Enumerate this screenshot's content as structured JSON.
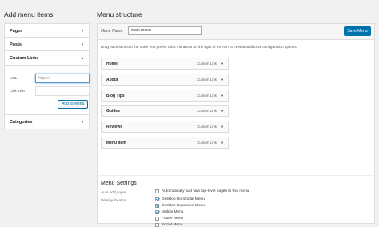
{
  "left": {
    "heading": "Add menu items",
    "pages_label": "Pages",
    "posts_label": "Posts",
    "custom_links_label": "Custom Links",
    "url_label": "URL",
    "url_value": "https://",
    "link_text_label": "Link Text",
    "add_to_menu_label": "Add to Menu",
    "categories_label": "Categories"
  },
  "right": {
    "heading": "Menu structure",
    "menu_name_label": "Menu Name",
    "menu_name_value": "main menu",
    "save_label": "Save Menu",
    "instructions": "Drag each item into the order you prefer. Click the arrow on the right of the item to reveal additional configuration options.",
    "items": [
      {
        "title": "Home",
        "type": "Custom Link"
      },
      {
        "title": "About",
        "type": "Custom Link"
      },
      {
        "title": "Blog Tips",
        "type": "Custom Link"
      },
      {
        "title": "Guides",
        "type": "Custom Link"
      },
      {
        "title": "Reviews",
        "type": "Custom Link"
      },
      {
        "title": "Menu Item",
        "type": "Custom Link"
      }
    ],
    "settings": {
      "title": "Menu Settings",
      "auto_add_label": "Auto add pages",
      "auto_add_text": "Automatically add new top-level pages to this menu",
      "display_label": "Display location",
      "locations": [
        {
          "label": "Desktop Horizontal Menu",
          "checked": true
        },
        {
          "label": "Desktop Expanded Menu",
          "checked": true
        },
        {
          "label": "Mobile Menu",
          "checked": true
        },
        {
          "label": "Footer Menu",
          "checked": false
        },
        {
          "label": "Social Menu",
          "checked": false
        }
      ]
    }
  }
}
